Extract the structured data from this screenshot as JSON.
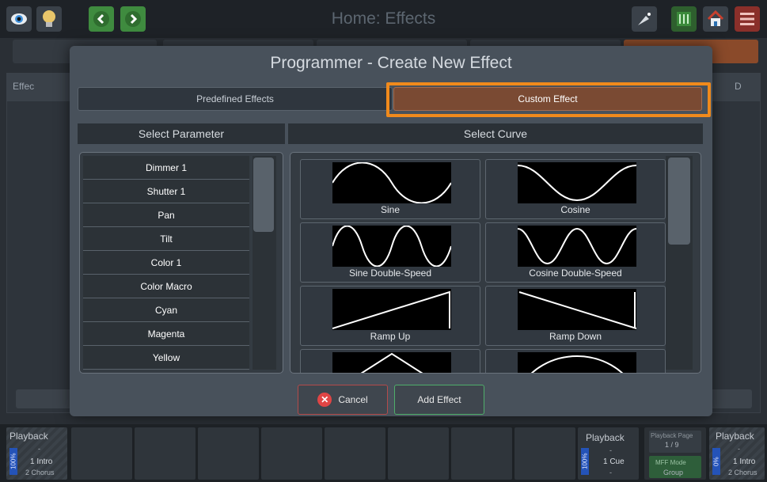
{
  "header": {
    "title": "Home: Effects"
  },
  "background": {
    "column_effects": "Effec",
    "column_d": "D"
  },
  "modal": {
    "title": "Programmer - Create New Effect",
    "tabs": [
      {
        "label": "Predefined Effects",
        "selected": false
      },
      {
        "label": "Custom Effect",
        "selected": true
      }
    ],
    "parameter_header": "Select Parameter",
    "curve_header": "Select Curve",
    "parameters": [
      "Dimmer 1",
      "Shutter 1",
      "Pan",
      "Tilt",
      "Color 1",
      "Color Macro",
      "Cyan",
      "Magenta",
      "Yellow"
    ],
    "curves": [
      "Sine",
      "Cosine",
      "Sine Double-Speed",
      "Cosine Double-Speed",
      "Ramp Up",
      "Ramp Down",
      "",
      ""
    ],
    "cancel_label": "Cancel",
    "add_label": "Add Effect"
  },
  "playback": {
    "left": {
      "title": "Playback",
      "level": "100%",
      "dash": "-",
      "cue": "1 Intro",
      "next": "2 Chorus"
    },
    "mid": {
      "title": "Playback",
      "level": "100%",
      "dash": "-",
      "cue": "1 Cue",
      "next": "-"
    },
    "page": {
      "title": "Playback Page",
      "value": "1 / 9",
      "mode": "MFF Mode",
      "group": "Group"
    },
    "right": {
      "title": "Playback",
      "level": "0%",
      "dash": "-",
      "cue": "1 Intro",
      "next": "2 Chorus"
    }
  },
  "colors": {
    "accent_orange": "#f08a1c",
    "selected_tab": "#7a4a33",
    "cancel_border": "#b44a4a",
    "add_border": "#4fae6a"
  }
}
